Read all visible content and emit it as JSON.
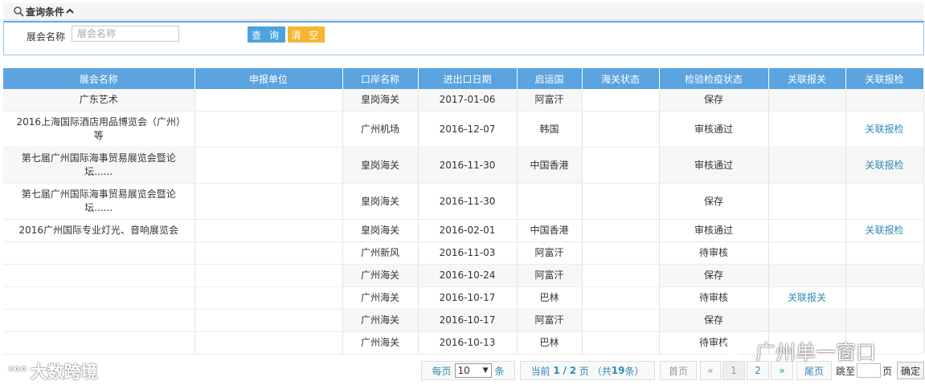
{
  "query": {
    "title": "查询条件",
    "label": "展会名称",
    "placeholder": "展会名称",
    "search_btn": "查 询",
    "clear_btn": "清 空"
  },
  "table": {
    "headers": [
      "展会名称",
      "申报单位",
      "口岸名称",
      "进出口日期",
      "启运国",
      "海关状态",
      "检验检疫状态",
      "关联报关",
      "关联报检"
    ],
    "rows": [
      [
        "广东艺术",
        "",
        "皇岗海关",
        "2017-01-06",
        "阿富汗",
        "",
        "保存",
        "",
        ""
      ],
      [
        "2016上海国际酒店用品博览会（广州）等",
        "",
        "广州机场",
        "2016-12-07",
        "韩国",
        "",
        "审核通过",
        "",
        "关联报检"
      ],
      [
        "第七届广州国际海事贸易展览会暨论坛......",
        "",
        "皇岗海关",
        "2016-11-30",
        "中国香港",
        "",
        "审核通过",
        "",
        "关联报检"
      ],
      [
        "第七届广州国际海事贸易展览会暨论坛......",
        "",
        "皇岗海关",
        "2016-11-30",
        "",
        "",
        "保存",
        "",
        ""
      ],
      [
        "2016广州国际专业灯光、音响展览会",
        "",
        "皇岗海关",
        "2016-02-01",
        "中国香港",
        "",
        "审核通过",
        "",
        "关联报检"
      ],
      [
        "",
        "",
        "广州新风",
        "2016-11-03",
        "阿富汗",
        "",
        "待审核",
        "",
        ""
      ],
      [
        "",
        "",
        "广州海关",
        "2016-10-24",
        "阿富汗",
        "",
        "保存",
        "",
        ""
      ],
      [
        "",
        "",
        "广州海关",
        "2016-10-17",
        "巴林",
        "",
        "待审核",
        "关联报关",
        ""
      ],
      [
        "",
        "",
        "广州海关",
        "2016-10-17",
        "阿富汗",
        "",
        "保存",
        "",
        ""
      ],
      [
        "",
        "",
        "广州海关",
        "2016-10-13",
        "巴林",
        "",
        "待审核",
        "",
        ""
      ]
    ]
  },
  "pager": {
    "per_page_prefix": "每页",
    "per_page_value": "10",
    "per_page_suffix": "条",
    "current_prefix": "当前",
    "current_page": "1",
    "total_pages": "2",
    "page_unit": "页",
    "total_prefix": "（共",
    "total_count": "19",
    "total_suffix": "条）",
    "first": "首页",
    "prev": "«",
    "page1": "1",
    "page2": "2",
    "next": "»",
    "last": "尾页",
    "jump_label": "跳至",
    "jump_unit": "页",
    "confirm": "确定"
  },
  "watermarks": {
    "left": "大数跨境",
    "right": "广州单一窗口"
  }
}
